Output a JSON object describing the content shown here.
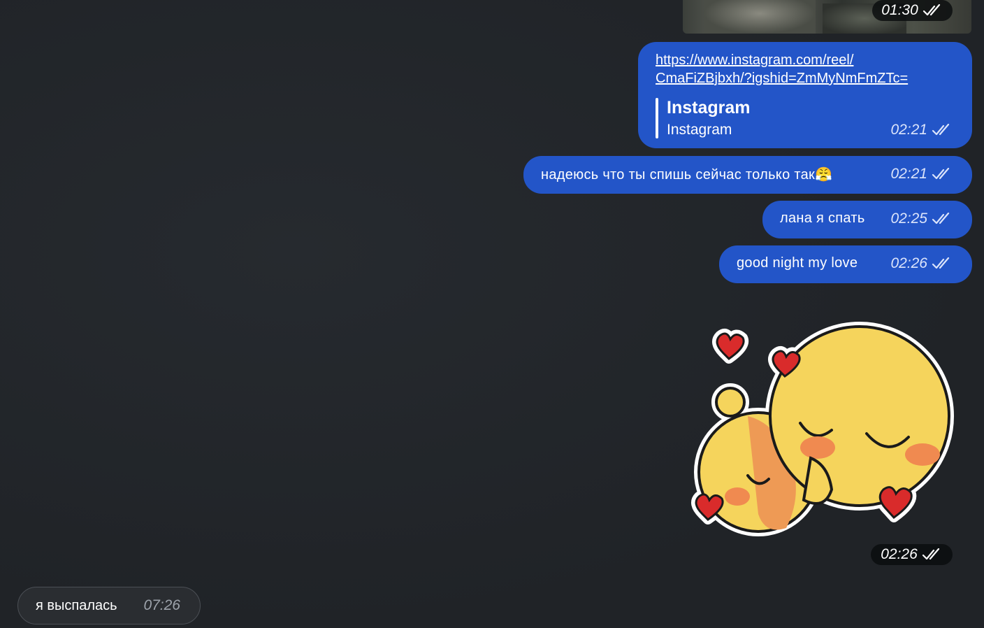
{
  "messages": {
    "photo": {
      "time": "01:30"
    },
    "link": {
      "url_line1": "https://www.instagram.com/reel/",
      "url_line2": "CmaFiZBjbxh/?igshid=ZmMyNmFmZTc=",
      "preview_title": "Instagram",
      "preview_desc": "Instagram",
      "time": "02:21"
    },
    "msg1": {
      "text": "надеюсь что ты спишь сейчас только так",
      "emoji": "😤",
      "time": "02:21"
    },
    "msg2": {
      "text": "лана я спать",
      "time": "02:25"
    },
    "msg3": {
      "text": "good night my love",
      "time": "02:26"
    },
    "sticker": {
      "time": "02:26"
    },
    "incoming": {
      "text": "я выспалась",
      "time": "07:26"
    }
  },
  "colors": {
    "outgoing_bubble": "#2355c8",
    "incoming_bubble": "#2a2d31",
    "background": "#22252a"
  },
  "icons": {
    "read_status": "double-check-icon",
    "sticker": "hugging-emoji-sticker"
  }
}
